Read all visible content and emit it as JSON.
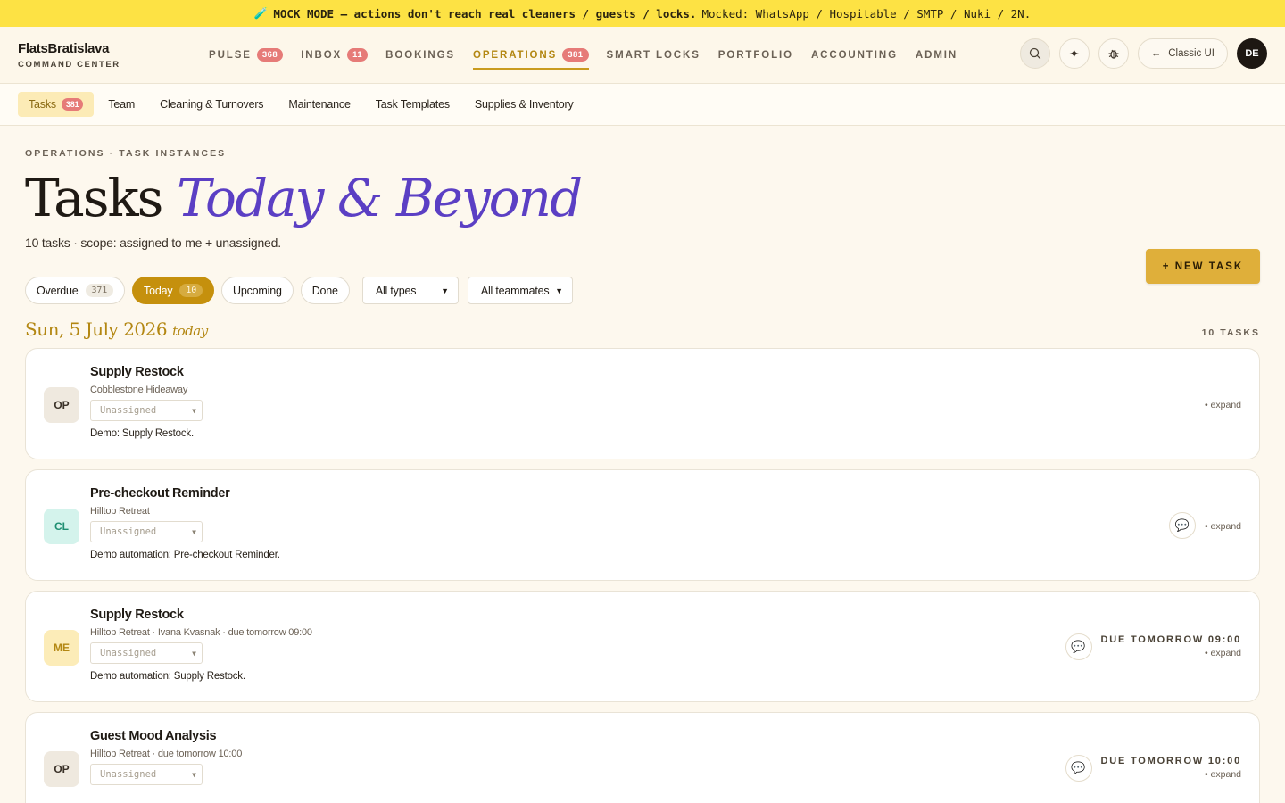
{
  "banner": {
    "icon": "🧪",
    "strong": "MOCK MODE — actions don't reach real cleaners / guests / locks.",
    "rest": "Mocked: WhatsApp / Hospitable / SMTP / Nuki / 2N."
  },
  "brand": {
    "name": "FlatsBratislava",
    "sub": "COMMAND CENTER"
  },
  "nav": [
    {
      "label": "PULSE",
      "count": "368"
    },
    {
      "label": "INBOX",
      "count": "11"
    },
    {
      "label": "BOOKINGS"
    },
    {
      "label": "OPERATIONS",
      "count": "381",
      "active": true
    },
    {
      "label": "SMART LOCKS"
    },
    {
      "label": "PORTFOLIO"
    },
    {
      "label": "ACCOUNTING"
    },
    {
      "label": "ADMIN"
    }
  ],
  "top_actions": {
    "classic_label": "Classic UI",
    "avatar": "DE"
  },
  "subnav": [
    {
      "label": "Tasks",
      "count": "381",
      "active": true
    },
    {
      "label": "Team"
    },
    {
      "label": "Cleaning & Turnovers"
    },
    {
      "label": "Maintenance"
    },
    {
      "label": "Task Templates"
    },
    {
      "label": "Supplies & Inventory"
    }
  ],
  "header": {
    "breadcrumb": "OPERATIONS · TASK INSTANCES",
    "title_main": "Tasks",
    "title_accent": "Today & Beyond",
    "subtitle": "10 tasks · scope: assigned to me + unassigned.",
    "new_task": "+ NEW TASK"
  },
  "filters": {
    "chips": [
      {
        "label": "Overdue",
        "count": "371"
      },
      {
        "label": "Today",
        "count": "10",
        "active": true
      },
      {
        "label": "Upcoming"
      },
      {
        "label": "Done"
      }
    ],
    "type_select": "All types",
    "teammate_select": "All teammates"
  },
  "day": {
    "title": "Sun, 5 July 2026",
    "tag": "today",
    "count": "10 TASKS"
  },
  "tasks": [
    {
      "initials": "OP",
      "avatar_bg": "#efe9df",
      "avatar_fg": "#3a3128",
      "title": "Supply Restock",
      "meta": "Cobblestone Hideaway",
      "assignee": "Unassigned",
      "desc": "Demo: Supply Restock.",
      "due": "",
      "has_chat": false,
      "expand": "• expand"
    },
    {
      "initials": "CL",
      "avatar_bg": "#d4f3ec",
      "avatar_fg": "#1f8f72",
      "title": "Pre-checkout Reminder",
      "meta": "Hilltop Retreat",
      "assignee": "Unassigned",
      "desc": "Demo automation: Pre-checkout Reminder.",
      "due": "",
      "has_chat": true,
      "expand": "• expand"
    },
    {
      "initials": "ME",
      "avatar_bg": "#fcecb8",
      "avatar_fg": "#b38712",
      "title": "Supply Restock",
      "meta": "Hilltop Retreat · Ivana Kvasnak · due tomorrow 09:00",
      "assignee": "Unassigned",
      "desc": "Demo automation: Supply Restock.",
      "due": "DUE TOMORROW 09:00",
      "has_chat": true,
      "expand": "• expand"
    },
    {
      "initials": "OP",
      "avatar_bg": "#efe9df",
      "avatar_fg": "#3a3128",
      "title": "Guest Mood Analysis",
      "meta": "Hilltop Retreat · due tomorrow 10:00",
      "assignee": "Unassigned",
      "desc": "",
      "due": "DUE TOMORROW 10:00",
      "has_chat": true,
      "expand": "• expand"
    }
  ]
}
